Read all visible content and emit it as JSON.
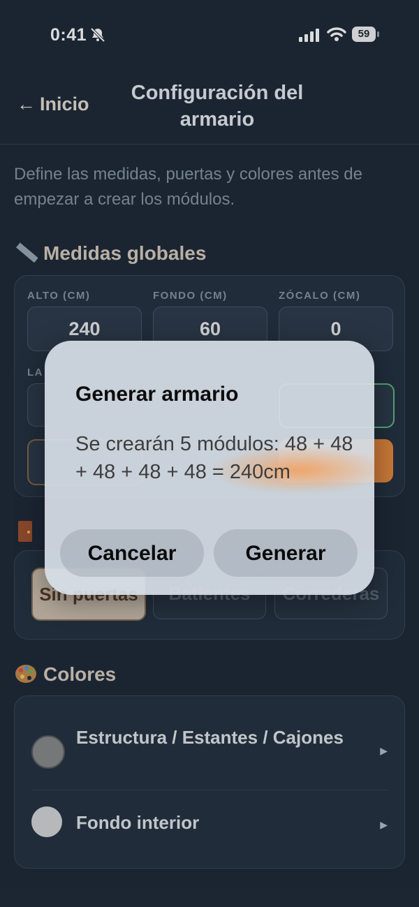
{
  "status_bar": {
    "time": "0:41",
    "battery": "59"
  },
  "header": {
    "back_label": "Inicio",
    "title": "Configuración del armario"
  },
  "intro": "Define las medidas, puertas y colores antes de empezar a crear los módulos.",
  "measures": {
    "title": "Medidas globales",
    "icon": "ruler-icon",
    "fields": [
      {
        "label": "ALTO (CM)",
        "value": "240"
      },
      {
        "label": "FONDO (CM)",
        "value": "60"
      },
      {
        "label": "ZÓCALO (CM)",
        "value": "0"
      }
    ],
    "second_row_label_partial": "LA"
  },
  "doors": {
    "icon": "door-icon",
    "options": [
      {
        "label": "Sin puertas",
        "active": true
      },
      {
        "label": "Batientes",
        "active": false
      },
      {
        "label": "Correderas",
        "active": false
      }
    ]
  },
  "colors": {
    "title": "Colores",
    "icon": "palette-icon",
    "items": [
      {
        "label": "Estructura / Estantes / Cajones",
        "swatch": "#8a8a8a"
      },
      {
        "label": "Fondo interior",
        "swatch": "#d6d6d6"
      }
    ]
  },
  "accent_colors": {
    "orange": "#e88a3c",
    "green": "#5fbf85",
    "bg": "#1f2a37"
  },
  "dialog": {
    "title": "Generar armario",
    "message": "Se crearán 5 módulos: 48 + 48 + 48 + 48 + 48 = 240cm",
    "cancel": "Cancelar",
    "confirm": "Generar"
  }
}
